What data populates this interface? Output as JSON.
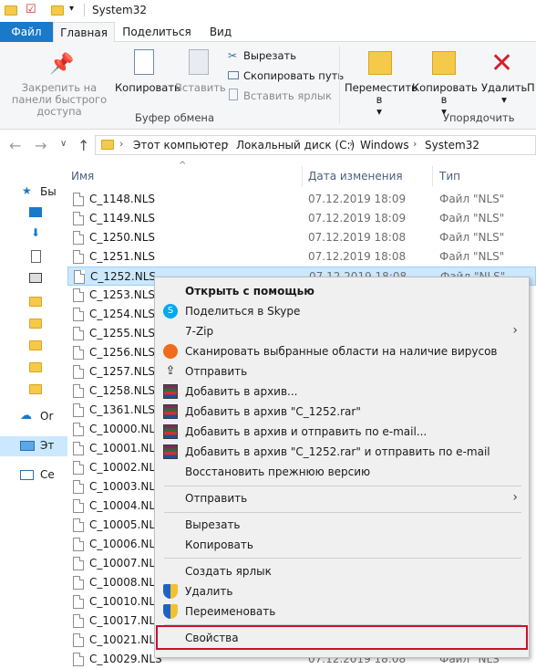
{
  "window": {
    "title": "System32"
  },
  "ribbon_tabs": [
    "Файл",
    "Главная",
    "Поделиться",
    "Вид"
  ],
  "ribbon": {
    "pin_label": "Закрепить на панели быстрого доступа",
    "copy_label": "Копировать",
    "paste_label": "Вставить",
    "cut_label": "Вырезать",
    "copy_path_label": "Скопировать путь",
    "paste_shortcut_label": "Вставить ярлык",
    "clipboard_group": "Буфер обмена",
    "move_to_label": "Переместить в",
    "copy_to_label": "Копировать в",
    "delete_label": "Удалить",
    "rename_label_partial": "П",
    "organize_group": "Упорядочить"
  },
  "address": {
    "crumbs": [
      "Этот компьютер",
      "Локальный диск (C:)",
      "Windows",
      "System32"
    ]
  },
  "nav": {
    "items": [
      "Бы",
      "",
      "",
      "",
      "",
      "",
      "",
      "",
      "",
      "",
      "Or",
      "Эт",
      "Се"
    ]
  },
  "columns": {
    "name": "Имя",
    "date": "Дата изменения",
    "type": "Тип"
  },
  "files": [
    {
      "name": "C_1148.NLS",
      "date": "07.12.2019 18:09",
      "type": "Файл \"NLS\""
    },
    {
      "name": "C_1149.NLS",
      "date": "07.12.2019 18:09",
      "type": "Файл \"NLS\""
    },
    {
      "name": "C_1250.NLS",
      "date": "07.12.2019 18:08",
      "type": "Файл \"NLS\""
    },
    {
      "name": "C_1251.NLS",
      "date": "07.12.2019 18:08",
      "type": "Файл \"NLS\""
    },
    {
      "name": "C_1252.NLS",
      "date": "07.12.2019 18:08",
      "type": "Файл \"NLS\""
    },
    {
      "name": "C_1253.NLS",
      "date": "",
      "type": ""
    },
    {
      "name": "C_1254.NLS",
      "date": "",
      "type": ""
    },
    {
      "name": "C_1255.NLS",
      "date": "",
      "type": ""
    },
    {
      "name": "C_1256.NLS",
      "date": "",
      "type": ""
    },
    {
      "name": "C_1257.NLS",
      "date": "",
      "type": ""
    },
    {
      "name": "C_1258.NLS",
      "date": "",
      "type": ""
    },
    {
      "name": "C_1361.NLS",
      "date": "",
      "type": ""
    },
    {
      "name": "C_10000.NLS",
      "date": "",
      "type": ""
    },
    {
      "name": "C_10001.NLS",
      "date": "",
      "type": ""
    },
    {
      "name": "C_10002.NLS",
      "date": "",
      "type": ""
    },
    {
      "name": "C_10003.NLS",
      "date": "",
      "type": ""
    },
    {
      "name": "C_10004.NLS",
      "date": "",
      "type": ""
    },
    {
      "name": "C_10005.NLS",
      "date": "",
      "type": ""
    },
    {
      "name": "C_10006.NLS",
      "date": "",
      "type": ""
    },
    {
      "name": "C_10007.NLS",
      "date": "",
      "type": ""
    },
    {
      "name": "C_10008.NLS",
      "date": "",
      "type": ""
    },
    {
      "name": "C_10010.NLS",
      "date": "",
      "type": ""
    },
    {
      "name": "C_10017.NLS",
      "date": "",
      "type": ""
    },
    {
      "name": "C_10021.NLS",
      "date": "",
      "type": ""
    },
    {
      "name": "C_10029.NLS",
      "date": "07.12.2019 18:08",
      "type": "Файл \"NLS\""
    }
  ],
  "context_menu": {
    "open_with": "Открыть с помощью",
    "share_skype": "Поделиться в Skype",
    "seven_zip": "7-Zip",
    "scan": "Сканировать выбранные области на наличие вирусов",
    "send": "Отправить",
    "add_archive": "Добавить в архив...",
    "add_rar": "Добавить в архив \"C_1252.rar\"",
    "add_email": "Добавить в архив и отправить по e-mail...",
    "add_rar_email": "Добавить в архив \"C_1252.rar\" и отправить по e-mail",
    "restore": "Восстановить прежнюю версию",
    "send_to": "Отправить",
    "cut": "Вырезать",
    "copy": "Копировать",
    "create_shortcut": "Создать ярлык",
    "delete": "Удалить",
    "rename": "Переименовать",
    "properties": "Свойства"
  },
  "colors": {
    "accent": "#1979ca",
    "selection": "#cce8ff",
    "highlight_border": "#c8102e"
  }
}
